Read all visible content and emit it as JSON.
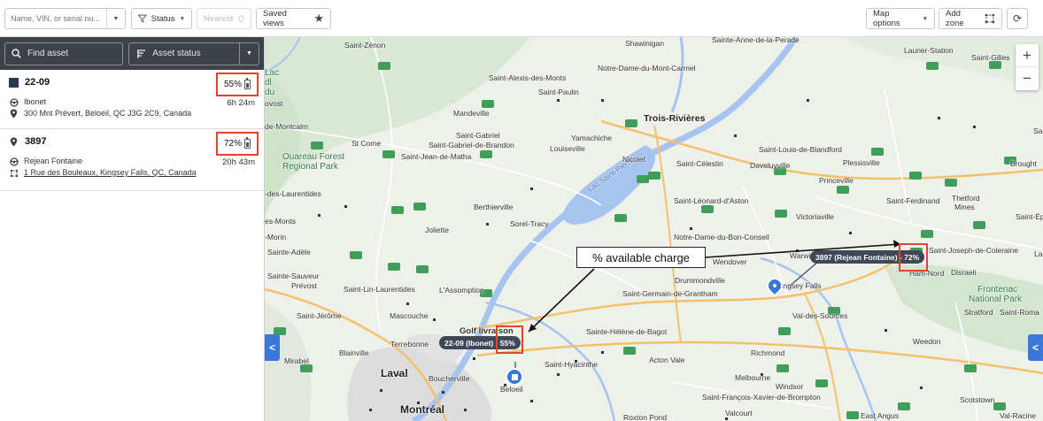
{
  "toolbar": {
    "search_placeholder": "Name, VIN, or serial nu...",
    "status_label": "Status",
    "nearest_label": "Nearest",
    "saved_views_label": "Saved views",
    "map_options_label": "Map options",
    "add_zone_label": "Add zone"
  },
  "sidebar": {
    "find_asset_label": "Find asset",
    "asset_status_label": "Asset status",
    "assets": [
      {
        "name": "22-09",
        "battery": "55%",
        "duration": "6h 24m",
        "driver": "Ibonet",
        "address": "300 Mnt Prévert, Beloeil, QC J3G 2C9, Canada"
      },
      {
        "name": "3897",
        "battery": "72%",
        "duration": "20h 43m",
        "driver": "Rejean Fontaine",
        "address": "1 Rue des Bouleaux, Kingsey Falls, QC, Canada"
      }
    ]
  },
  "map": {
    "zoom_in": "+",
    "zoom_out": "−",
    "callout": "% available charge",
    "marker_labels": {
      "asset_1": "22-09 (Ibonet) - 55%",
      "asset_2": "3897 (Rejean Fontaine) - 72%"
    },
    "places": {
      "saint_zenon": "Saint-Zénon",
      "shawinigan": "Shawinigan",
      "sainte_anne": "Sainte-Anne-de-la-Perade",
      "laurier_station": "Laurier-Station",
      "saint_gilles": "Saint-Gilles",
      "saint_alexis": "Saint-Alexis-des-Monts",
      "notre_dame_carmel": "Notre-Dame-du-Mont-Carmel",
      "saint_paulin": "Saint-Paulin",
      "mandeville": "Mandeville",
      "trois_rivieres": "Trois-Rivières",
      "st_come": "St Come",
      "saint_gabriel": "Saint-Gabriel",
      "saint_gabriel_brandon": "Saint-Gabriel-de-Brandon",
      "yamachiche": "Yamachiche",
      "louiseville": "Louiseville",
      "saint_jean_matha": "Saint-Jean-de-Matha",
      "ouareau_1": "Ouareau Forest",
      "ouareau_2": "Regional Park",
      "lac_saint_pierre": "Lac Saint-Pierre",
      "nicolet": "Nicolet",
      "saint_celestin": "Saint-Célestin",
      "daveluyville": "Daveluyville",
      "plessisville": "Plessisville",
      "saint_louis_blandford": "Saint-Louis-de-Blandford",
      "princeville": "Princeville",
      "saint_leonard_aston": "Saint-Léonard-d'Aston",
      "victoriaville": "Victoriaville",
      "saint_ferdinand": "Saint-Ferdinand",
      "thetford": "Thetford",
      "mines": "Mines",
      "berthierville": "Berthierville",
      "sorel_tracy": "Sorel-Tracy",
      "joliette": "Joliette",
      "notre_dame_bon_conseil": "Notre-Dame-du-Bon-Conseil",
      "saint_joseph_coleraine": "Saint-Joseph-de-Coleraine",
      "warwick": "Warwick",
      "wendover": "Wendover",
      "drummondville": "Drummondville",
      "kingsey_falls": "Kingsey Falls",
      "ham_nord": "Ham-Nord",
      "disraeli": "Disraeli",
      "frontenac_1": "Frontenac",
      "frontenac_2": "National Park",
      "saint_germain": "Saint-Germain-de-Grantham",
      "val_des_sources": "Val-des-Sources",
      "stratford": "Stratford",
      "saint_roma": "Saint-Roma",
      "saint_lin": "Saint-Lin-Laurentides",
      "lassomption": "L'Assomption",
      "mascouche": "Mascouche",
      "saint_jerome": "Saint-Jérôme",
      "terrebonne": "Terrebonne",
      "blainville": "Blainville",
      "mirabel": "Mirabel",
      "laval": "Laval",
      "boucherville": "Boucherville",
      "montreal": "Montréal",
      "beloeil": "Beloeil",
      "golf_livraison": "Golf livraison",
      "saint_hyacinthe": "Saint-Hyacinthe",
      "sainte_helene": "Sainte-Hélène-de-Bagot",
      "acton_vale": "Acton Vale",
      "richmond": "Richmond",
      "melbourne": "Melbourne",
      "windsor": "Windsor",
      "saint_francois": "Saint-François-Xavier-de-Brompton",
      "weedon": "Weedon",
      "scotstown": "Scotstown",
      "valcourt": "Valcourt",
      "east_angus": "East Angus",
      "val_racine": "Val-Racine",
      "roxton_pond": "Roxton Pond",
      "sainte_adele": "Sainte-Adèle",
      "sainte_sauveur": "Sainte-Sauveur",
      "prevost": "Prévost",
      "morin": "-Morin",
      "monts": "es-Monts",
      "laurentides": "-des-Laurentides",
      "montcalm": "de-Montcalm",
      "ovost": "ovost",
      "dl": "dl",
      "du_lac": "du",
      "lac": "Lac",
      "brought": "Brought",
      "saint_ep": "Saint-Ép",
      "sa": "Sa",
      "la": "La"
    }
  }
}
